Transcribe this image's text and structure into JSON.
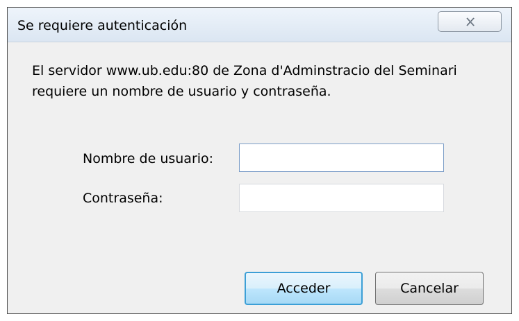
{
  "dialog": {
    "title": "Se requiere autenticación",
    "message": "El servidor www.ub.edu:80 de Zona d'Adminstracio del Seminari requiere un nombre de usuario y contraseña.",
    "username_label": "Nombre de usuario:",
    "username_value": "",
    "password_label": "Contraseña:",
    "password_value": "",
    "accept_label": "Acceder",
    "cancel_label": "Cancelar",
    "close_icon": "close-icon"
  }
}
